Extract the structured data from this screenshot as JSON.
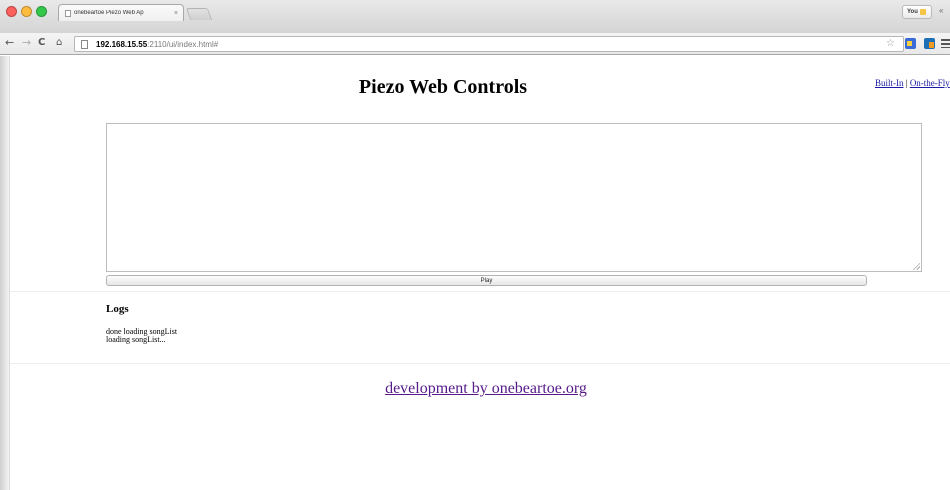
{
  "browser": {
    "tab_title": "onebeartoe Piezo Web Ap",
    "tab_close": "×",
    "profile_label": "You",
    "url_host": "192.168.15.55",
    "url_path": ":2110/ui/index.html#"
  },
  "page": {
    "title": "Piezo Web Controls",
    "links": {
      "built_in": "Built-In",
      "separator": " | ",
      "on_the_fly": "On-the-Fly"
    },
    "play_label": "Play",
    "song_text": "",
    "logs_title": "Logs",
    "logs": [
      "done loading songList",
      "loading songList..."
    ],
    "footer_link": "development by onebeartoe.org"
  }
}
